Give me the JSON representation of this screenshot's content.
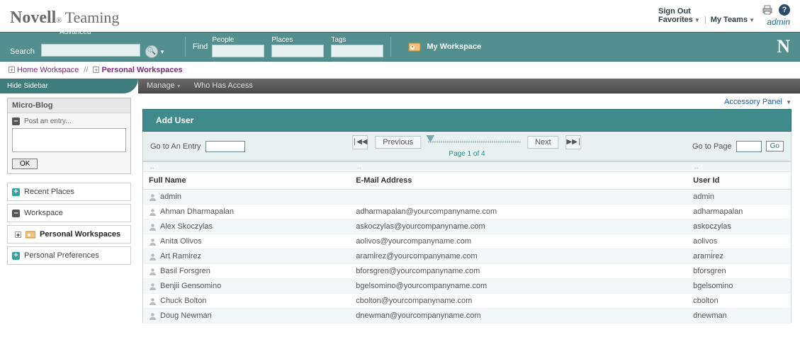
{
  "header": {
    "brand1": "Novell",
    "reg": "®",
    "brand2": "Teaming",
    "signout": "Sign Out",
    "favorites": "Favorites",
    "myteams": "My Teams",
    "admin": "admin"
  },
  "tealbar": {
    "advanced": "Advanced",
    "search": "Search",
    "find": "Find",
    "people": "People",
    "places": "Places",
    "tags": "Tags",
    "myworkspace": "My Workspace",
    "nlogo": "N"
  },
  "crumb": {
    "home": "Home Workspace",
    "sep": "//",
    "personal": "Personal Workspaces"
  },
  "darkbar": {
    "hide": "Hide Sidebar",
    "manage": "Manage",
    "who": "Who Has Access"
  },
  "sidebar": {
    "microblog": "Micro-Blog",
    "post": "Post an entry...",
    "ok": "OK",
    "recent": "Recent Places",
    "workspace": "Workspace",
    "pw": "Personal Workspaces",
    "prefs": "Personal Preferences"
  },
  "main": {
    "accessory": "Accessory Panel",
    "adduser": "Add User",
    "goentry": "Go to An Entry",
    "previous": "Previous",
    "next": "Next",
    "pageof": "Page 1 of 4",
    "gopage": "Go to Page",
    "go": "Go",
    "col_fullname": "Full Name",
    "col_email": "E-Mail Address",
    "col_uid": "User Id"
  },
  "rows": [
    {
      "name": "admin",
      "email": "",
      "uid": "admin"
    },
    {
      "name": "Ahman Dharmapalan",
      "email": "adharmapalan@yourcompanyname.com",
      "uid": "adharmapalan"
    },
    {
      "name": "Alex Skoczylas",
      "email": "askoczylas@yourcompanyname.com",
      "uid": "askoczylas"
    },
    {
      "name": "Anita Olivos",
      "email": "aolivos@yourcompanyname.com",
      "uid": "aolivos"
    },
    {
      "name": "Art Ramirez",
      "email": "aramirez@yourcompanyname.com",
      "uid": "aramirez"
    },
    {
      "name": "Basil Forsgren",
      "email": "bforsgren@yourcompanyname.com",
      "uid": "bforsgren"
    },
    {
      "name": "Benjii Gensomino",
      "email": "bgelsomino@yourcompanyname.com",
      "uid": "bgelsomino"
    },
    {
      "name": "Chuck Bolton",
      "email": "cbolton@yourcompanyname.com",
      "uid": "cbolton"
    },
    {
      "name": "Doug Newman",
      "email": "dnewman@yourcompanyname.com",
      "uid": "dnewman"
    }
  ]
}
